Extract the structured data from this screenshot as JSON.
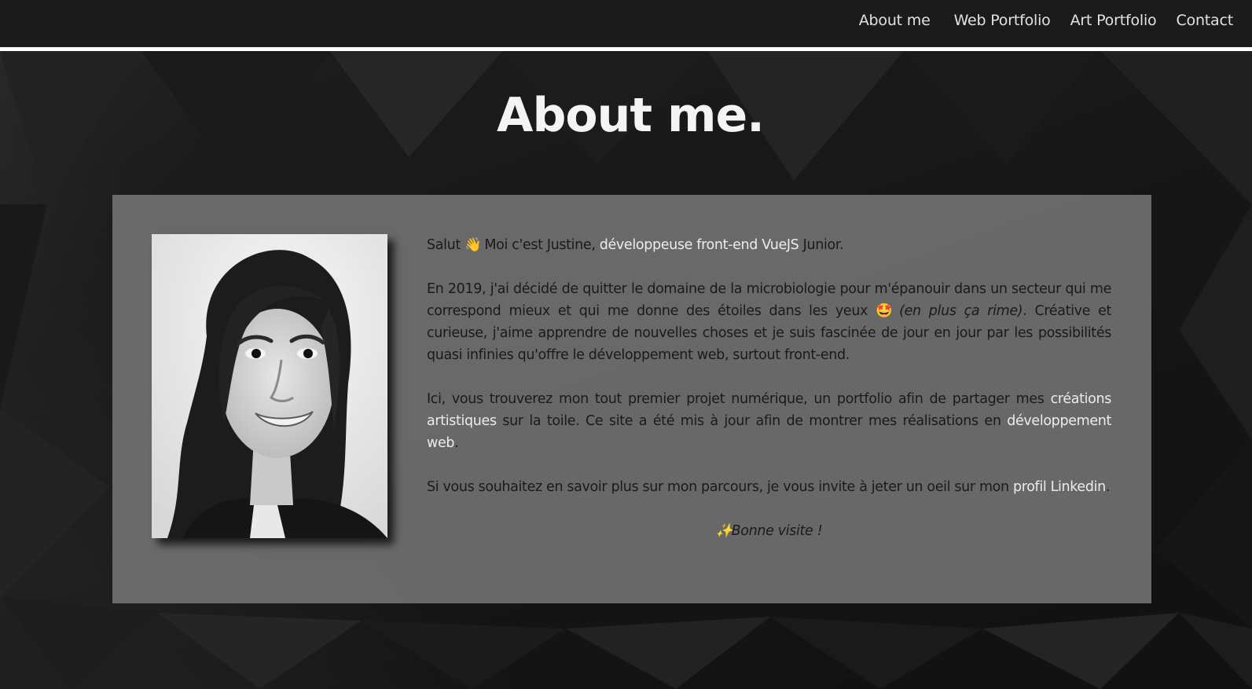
{
  "nav": {
    "links": [
      "About me",
      "Web Portfolio",
      "Art Portfolio",
      "Contact"
    ]
  },
  "page_title": "About me.",
  "photo": {
    "icon": "portrait-photo"
  },
  "intro": {
    "greeting": "Salut",
    "wave_emoji": "👋",
    "text1": "Moi c'est Justine,",
    "role": "développeuse front-end VueJS",
    "level": "Junior."
  },
  "paragraph2": {
    "text1": "En 2019, j'ai décidé de quitter le domaine de la microbiologie pour m'épanouir dans un secteur qui me correspond mieux et qui me donne des étoiles dans les yeux",
    "star_emoji": "🤩",
    "rhyme": "(en plus ça rime)",
    "text2": ". Créative et curieuse, j'aime apprendre de nouvelles choses et je suis fascinée de jour en jour par les possibilités quasi infinies qu'offre le développement web, surtout front-end."
  },
  "paragraph3": {
    "text1": "Ici, vous trouverez mon tout premier projet numérique, un portfolio afin de partager mes",
    "link_art": "créations artistiques",
    "text2": "sur la toile. Ce site a été mis à jour afin de montrer mes réalisations en",
    "link_web": "développement web",
    "text3": "."
  },
  "paragraph4": {
    "text1": "Si vous souhaitez en savoir plus sur mon parcours, je vous invite à jeter un oeil sur mon",
    "link_linkedin": "profil Linkedin",
    "text2": "."
  },
  "closing": {
    "sparkle_emoji": "✨",
    "text": "Bonne visite !"
  },
  "colors": {
    "navbar": "#1b1b1b",
    "card": "#808080",
    "highlight_text": "#ececec"
  }
}
